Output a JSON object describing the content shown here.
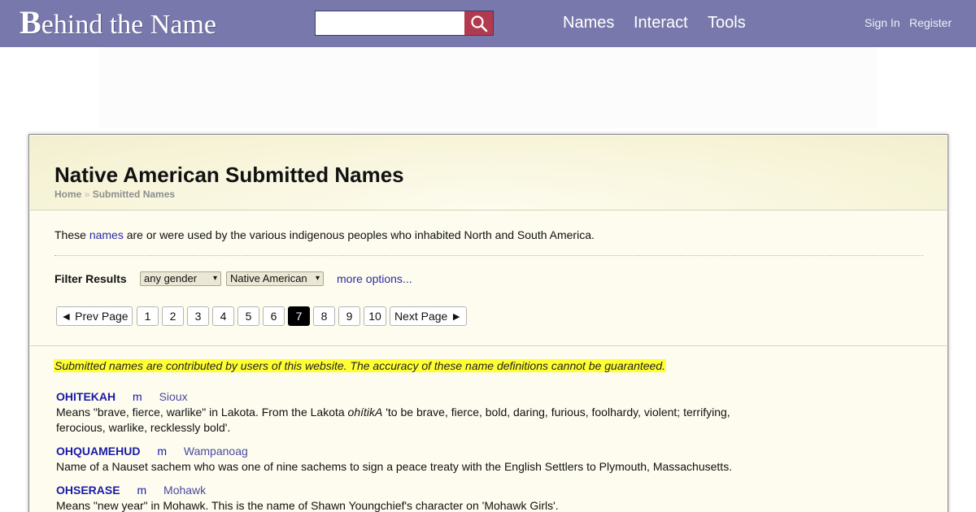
{
  "header": {
    "logo_first": "B",
    "logo_rest": "ehind the Name",
    "search": {
      "placeholder": "",
      "value": "",
      "icon": "search-icon"
    },
    "nav": [
      "Names",
      "Interact",
      "Tools"
    ],
    "account": {
      "sign_in": "Sign In",
      "register": "Register"
    },
    "colors": {
      "bar": "#7878ac",
      "search_button": "#b33a4e"
    }
  },
  "page": {
    "title": "Native American Submitted Names",
    "breadcrumb": {
      "home": "Home",
      "separator": "»",
      "current": "Submitted Names"
    },
    "intro": {
      "before": "These ",
      "link": "names",
      "after": " are or were used by the various indigenous peoples who inhabited North and South America."
    }
  },
  "filters": {
    "label": "Filter Results",
    "gender": "any gender",
    "usage": "Native American",
    "more_options": "more options...",
    "arrow": "▾"
  },
  "pagination": {
    "prev": "◄ Prev Page",
    "pages": [
      "1",
      "2",
      "3",
      "4",
      "5",
      "6",
      "7",
      "8",
      "9",
      "10"
    ],
    "current": "7",
    "next": "Next Page ►"
  },
  "disclaimer": "Submitted names are contributed by users of this website. The accuracy of these name definitions cannot be guaranteed.",
  "entries": [
    {
      "name": "OHITEKAH",
      "gender": "m",
      "usage": "Sioux",
      "desc_before": "Means \"brave, fierce, warlike\" in Lakota. From the Lakota ",
      "desc_italic": "ohítikA",
      "desc_after": " 'to be brave, fierce, bold, daring, furious, foolhardy, violent; terrifying, ferocious, warlike, recklessly bold'."
    },
    {
      "name": "OHQUAMEHUD",
      "gender": "m",
      "usage": "Wampanoag",
      "desc_before": "Name of a Nauset sachem who was one of nine sachems to sign a peace treaty with the English Settlers to Plymouth, Massachusetts.",
      "desc_italic": "",
      "desc_after": ""
    },
    {
      "name": "OHSERASE",
      "gender": "m",
      "usage": "Mohawk",
      "desc_before": "Means \"new year\" in Mohawk. This is the name of Shawn Youngchief's character on 'Mohawk Girls'.",
      "desc_italic": "",
      "desc_after": ""
    }
  ]
}
